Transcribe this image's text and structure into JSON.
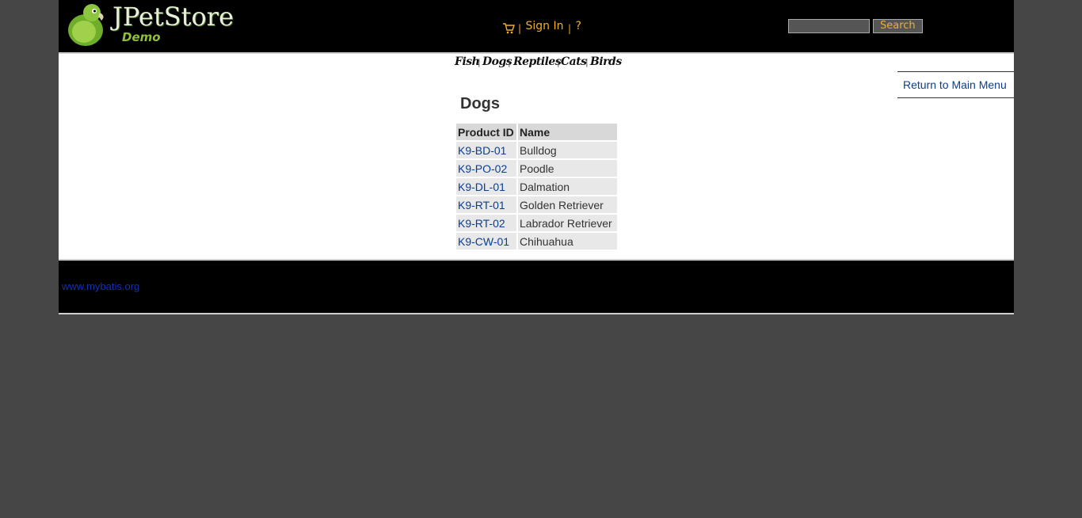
{
  "header": {
    "brand": "JPetStore",
    "subtitle": "Demo",
    "sign_in": "Sign In",
    "help": "?",
    "separator": "|",
    "search_button": "Search",
    "search_value": ""
  },
  "quicklinks": [
    "Fish",
    "Dogs",
    "Reptiles",
    "Cats",
    "Birds"
  ],
  "backlink": "Return to Main Menu",
  "catalog": {
    "title": "Dogs",
    "columns": [
      "Product ID",
      "Name"
    ],
    "rows": [
      {
        "id": "K9-BD-01",
        "name": "Bulldog"
      },
      {
        "id": "K9-PO-02",
        "name": "Poodle"
      },
      {
        "id": "K9-DL-01",
        "name": "Dalmation"
      },
      {
        "id": "K9-RT-01",
        "name": "Golden Retriever"
      },
      {
        "id": "K9-RT-02",
        "name": "Labrador Retriever"
      },
      {
        "id": "K9-CW-01",
        "name": "Chihuahua"
      }
    ]
  },
  "footer": {
    "link": "www.mybatis.org"
  },
  "colors": {
    "page_bg": "#464646",
    "header_bg": "#000000",
    "menu_text": "#f0b028",
    "link": "#0a3e8f"
  }
}
